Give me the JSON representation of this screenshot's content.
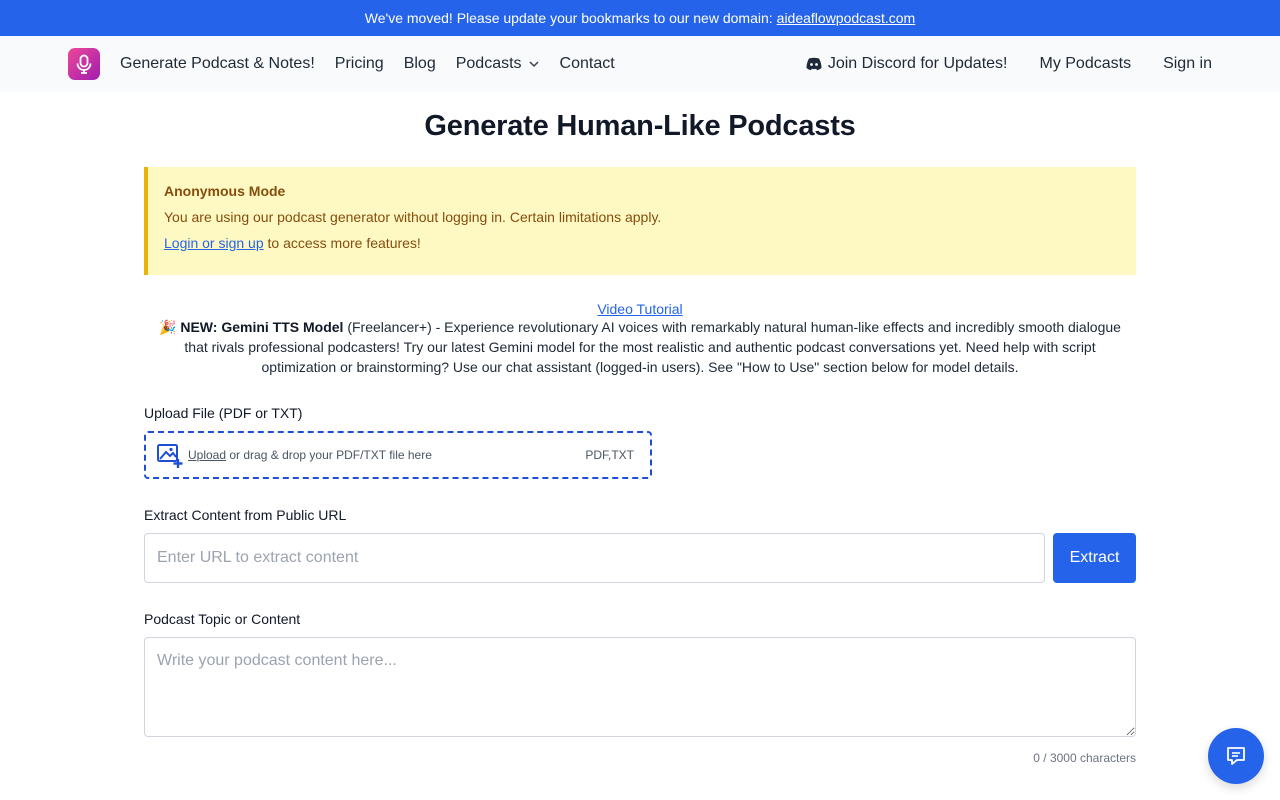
{
  "banner": {
    "text": "We've moved! Please update your bookmarks to our new domain:",
    "link": "aideaflowpodcast.com"
  },
  "nav": {
    "logo_icon": "microphone-icon",
    "links": [
      "Generate Podcast & Notes!",
      "Pricing",
      "Blog",
      "Podcasts",
      "Contact"
    ],
    "discord": "Join Discord for Updates!",
    "my_podcasts": "My Podcasts",
    "sign_in": "Sign in"
  },
  "page": {
    "title": "Generate Human-Like Podcasts"
  },
  "alert": {
    "title": "Anonymous Mode",
    "message": "You are using our podcast generator without logging in. Certain limitations apply.",
    "link": "Login or sign up",
    "link_suffix": "to access more features!"
  },
  "announcement": {
    "tutorial_link": "Video Tutorial",
    "emoji": "🎉",
    "bold": "NEW: Gemini TTS Model",
    "text": " (Freelancer+) - Experience revolutionary AI voices with remarkably natural human-like effects and incredibly smooth dialogue that rivals professional podcasters! Try our latest Gemini model for the most realistic and authentic podcast conversations yet. Need help with script optimization or brainstorming? Use our chat assistant (logged-in users). See \"How to Use\" section below for model details."
  },
  "upload": {
    "label": "Upload File (PDF or TXT)",
    "link": "Upload",
    "text": "or drag & drop your PDF/TXT file here",
    "types": "PDF,TXT"
  },
  "url_extract": {
    "label": "Extract Content from Public URL",
    "placeholder": "Enter URL to extract content",
    "button": "Extract"
  },
  "content": {
    "label": "Podcast Topic or Content",
    "placeholder": "Write your podcast content here...",
    "counter": "0 / 3000 characters"
  },
  "colors": {
    "primary": "#2563eb",
    "alert_bg": "#fef9c3",
    "alert_border": "#eab308",
    "alert_text": "#854d0e"
  }
}
